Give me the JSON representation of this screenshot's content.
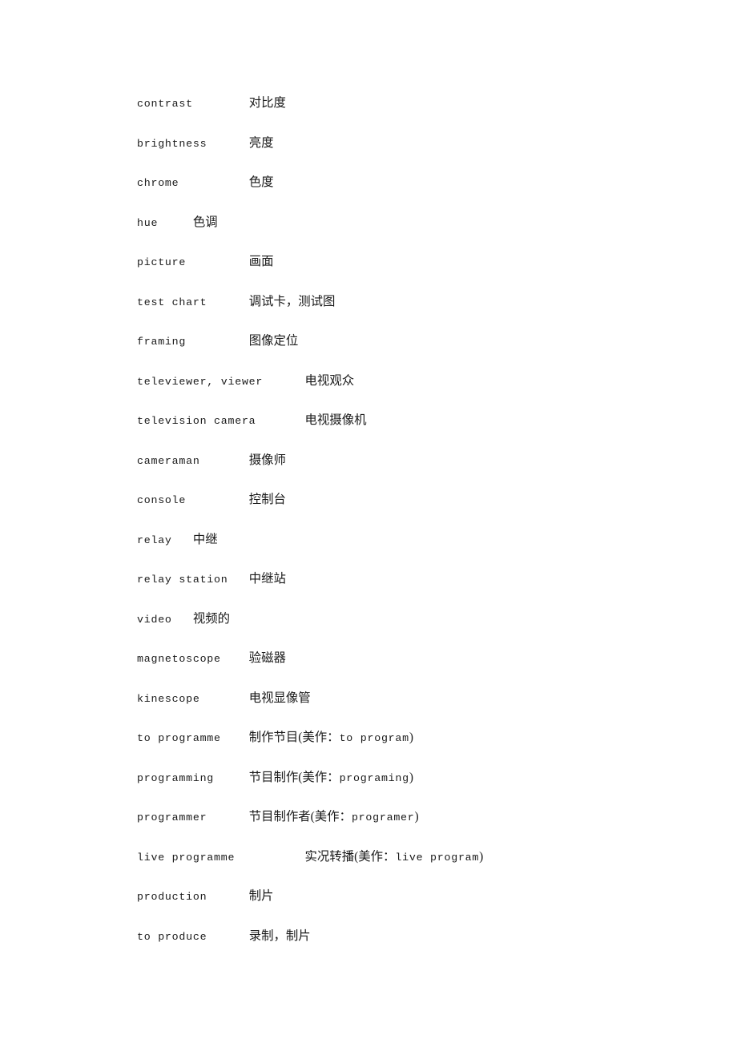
{
  "document": {
    "type": "bilingual-glossary",
    "topic": "television terminology",
    "entries": [
      {
        "term": "contrast",
        "gap": "\t",
        "gloss": "对比度"
      },
      {
        "term": "brightness",
        "gap": "\t",
        "gloss": "亮度"
      },
      {
        "term": "chrome",
        "gap": "\t",
        "gloss": "色度"
      },
      {
        "term": "hue",
        "gap": "\t",
        "gloss": "色调"
      },
      {
        "term": "picture",
        "gap": "\t",
        "gloss": "画面"
      },
      {
        "term": "test chart",
        "gap": "\t",
        "gloss": "调试卡，测试图"
      },
      {
        "term": "framing",
        "gap": "\t",
        "gloss": "图像定位"
      },
      {
        "term": "televiewer, viewer",
        "gap": "\t",
        "gloss": "电视观众"
      },
      {
        "term": "television camera",
        "gap": "\t",
        "gloss": "电视摄像机"
      },
      {
        "term": "cameraman",
        "gap": "\t",
        "gloss": "摄像师"
      },
      {
        "term": "console",
        "gap": "\t",
        "gloss": "控制台"
      },
      {
        "term": "relay",
        "gap": "\t",
        "gloss": "中继"
      },
      {
        "term": "relay station",
        "gap": "\t",
        "gloss": "中继站"
      },
      {
        "term": "video",
        "gap": "\t",
        "gloss": "视频的"
      },
      {
        "term": "magnetoscope",
        "gap": "\t",
        "gloss": "验磁器"
      },
      {
        "term": "kinescope",
        "gap": "\t",
        "gloss": "电视显像管"
      },
      {
        "term": "to programme",
        "gap": "\t",
        "gloss": "制作节目(美作：",
        "gloss_latin": "to program",
        "gloss_tail": ")"
      },
      {
        "term": "programming",
        "gap": "\t",
        "gloss": "节目制作(美作：",
        "gloss_latin": "programing",
        "gloss_tail": ")"
      },
      {
        "term": "programmer",
        "gap": "\t",
        "gloss": "节目制作者(美作：",
        "gloss_latin": "programer",
        "gloss_tail": ")"
      },
      {
        "term": "live programme",
        "gap": "\t",
        "gloss": "实况转播(美作：",
        "gloss_latin": "live program",
        "gloss_tail": ")"
      },
      {
        "term": "production",
        "gap": "\t",
        "gloss": "制片"
      },
      {
        "term": "to produce",
        "gap": "\t",
        "gloss": "录制，制片"
      }
    ]
  }
}
